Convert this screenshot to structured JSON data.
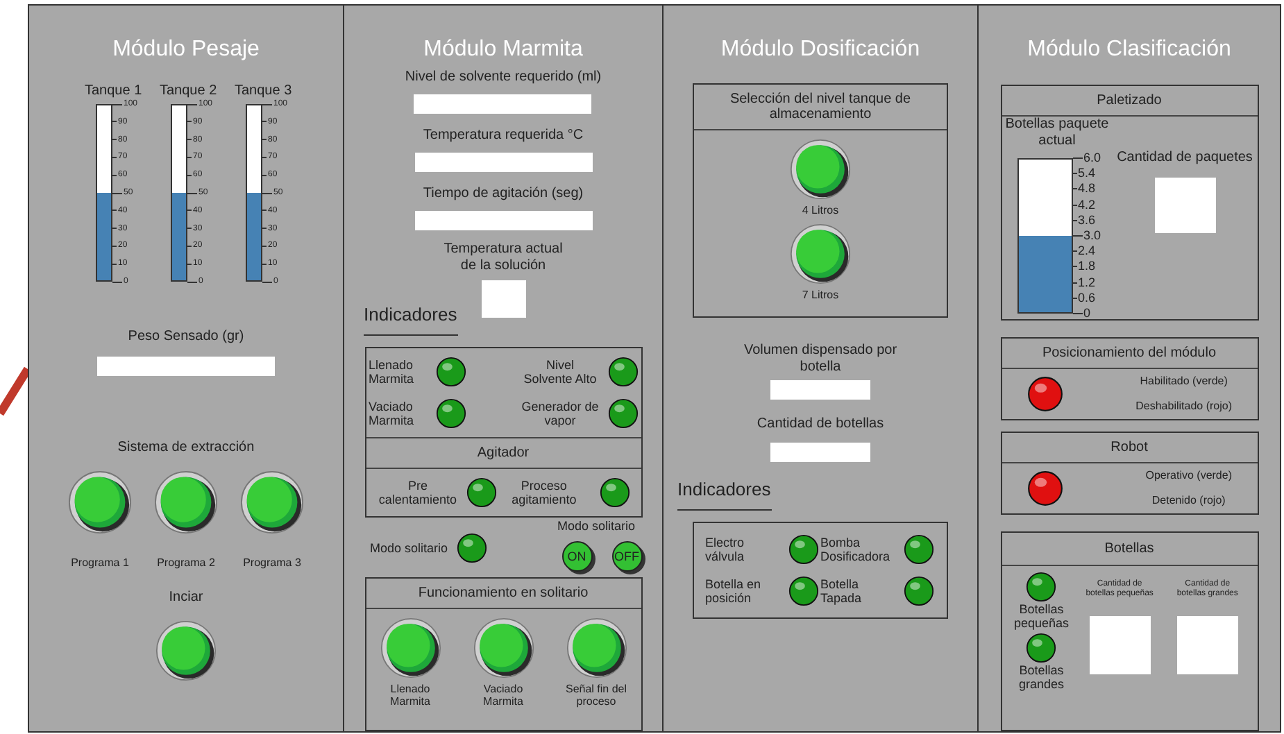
{
  "pesaje": {
    "title": "Módulo Pesaje",
    "tanks": [
      {
        "label": "Tanque 1",
        "level": 0.5,
        "ticks": [
          "100",
          "90",
          "80",
          "70",
          "60",
          "50",
          "40",
          "30",
          "20",
          "10",
          "0"
        ]
      },
      {
        "label": "Tanque 2",
        "level": 0.5,
        "ticks": [
          "100",
          "90",
          "80",
          "70",
          "60",
          "50",
          "40",
          "30",
          "20",
          "10",
          "0"
        ]
      },
      {
        "label": "Tanque 3",
        "level": 0.5,
        "ticks": [
          "100",
          "90",
          "80",
          "70",
          "60",
          "50",
          "40",
          "30",
          "20",
          "10",
          "0"
        ]
      }
    ],
    "weight": {
      "label": "Peso Sensado (gr)"
    },
    "extraction": {
      "label": "Sistema de extracción",
      "buttons": [
        {
          "label": "Programa 1"
        },
        {
          "label": "Programa 2"
        },
        {
          "label": "Programa 3"
        }
      ]
    },
    "start": {
      "label": "Inciar"
    }
  },
  "marmita": {
    "title": "Módulo Marmita",
    "fields": [
      {
        "label": "Nivel de solvente requerido (ml)"
      },
      {
        "label": "Temperatura requerida °C"
      },
      {
        "label": "Tiempo de agitación (seg)"
      }
    ],
    "current_temp": {
      "label": "Temperatura actual de la solución"
    },
    "indicators_title": "Indicadores",
    "lamps": [
      {
        "label": "Llenado Marmita",
        "color": "#1a9a1a"
      },
      {
        "label": "Nivel Solvente Alto",
        "color": "#1a9a1a"
      },
      {
        "label": "Vaciado Marmita",
        "color": "#1a9a1a"
      },
      {
        "label": "Generador de vapor",
        "color": "#1a9a1a"
      }
    ],
    "agitator": {
      "title": "Agitador",
      "lamps": [
        {
          "label": "Pre calentamiento",
          "color": "#1a9a1a"
        },
        {
          "label": "Proceso agitamiento",
          "color": "#1a9a1a"
        }
      ]
    },
    "solo_lamp": {
      "label": "Modo solitario",
      "color": "#1a9a1a"
    },
    "solo_switch": {
      "label": "Modo solitario",
      "buttons": [
        "ON",
        "OFF"
      ]
    },
    "solo_panel": {
      "title": "Funcionamiento en solitario",
      "buttons": [
        {
          "label": "Llenado Marmita"
        },
        {
          "label": "Vaciado Marmita"
        },
        {
          "label": "Señal fin del proceso"
        }
      ]
    }
  },
  "dosificacion": {
    "title": "Módulo Dosificación",
    "selector": {
      "title": "Selección del nivel tanque de almacenamiento",
      "buttons": [
        {
          "label": "4 Litros"
        },
        {
          "label": "7 Litros"
        }
      ]
    },
    "fields": [
      {
        "label": "Volumen dispensado por botella"
      },
      {
        "label": "Cantidad de botellas"
      }
    ],
    "indicators_title": "Indicadores",
    "lamps": [
      {
        "label": "Electro válvula",
        "color": "#1a9a1a"
      },
      {
        "label": "Bomba Dosificadora",
        "color": "#1a9a1a"
      },
      {
        "label": "Botella en posición",
        "color": "#1a9a1a"
      },
      {
        "label": "Botella Tapada",
        "color": "#1a9a1a"
      }
    ]
  },
  "clasificacion": {
    "title": "Módulo Clasificación",
    "palletizing": {
      "title": "Paletizado",
      "gauge": {
        "label": "Botellas paquete actual",
        "level": 0.5,
        "ticks": [
          "6.0",
          "5.4",
          "4.8",
          "4.2",
          "3.6",
          "3.0",
          "2.4",
          "1.8",
          "1.2",
          "0.6",
          "0"
        ]
      },
      "count": {
        "label": "Cantidad de paquetes"
      }
    },
    "positioning": {
      "title": "Posicionamiento del módulo",
      "color": "#e01010",
      "legend": [
        "Habilitado (verde)",
        "Deshabilitado (rojo)"
      ]
    },
    "robot": {
      "title": "Robot",
      "color": "#e01010",
      "legend": [
        "Operativo (verde)",
        "Detenido (rojo)"
      ]
    },
    "bottles": {
      "title": "Botellas",
      "lamps": [
        {
          "label": "Botellas pequeñas",
          "color": "#1a9a1a"
        },
        {
          "label": "Botellas grandes",
          "color": "#1a9a1a"
        }
      ],
      "counts": [
        {
          "label": "Cantidad de botellas pequeñas"
        },
        {
          "label": "Cantidad de botellas grandes"
        }
      ]
    }
  }
}
